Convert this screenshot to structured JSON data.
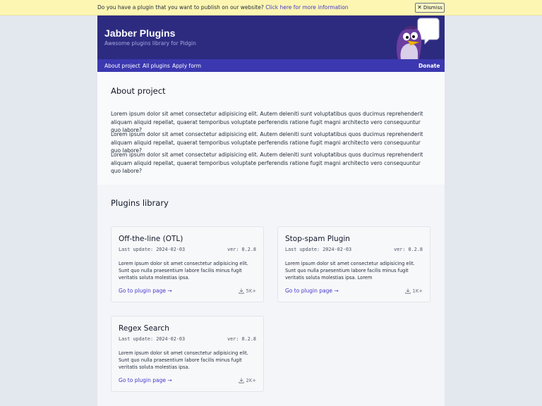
{
  "banner": {
    "text": "Do you have a plugin that you want to publish on our website?",
    "link": "Click here for more information",
    "dismiss": "Dismiss"
  },
  "header": {
    "title": "Jabber Plugins",
    "subtitle": "Awesome plugins library for Pidgin"
  },
  "nav": {
    "items": [
      "About project",
      "All plugins",
      "Apply form"
    ],
    "donate": "Donate"
  },
  "about": {
    "title": "About project",
    "paragraphs": [
      "Lorem ipsum dolor sit amet consectetur adipisicing elit. Autem deleniti sunt voluptatibus quos ducimus reprehenderit aliquam aliquid repellat, quaerat temporibus voluptate perferendis ratione fugit magni architecto vero consequuntur quo labore?",
      "Lorem ipsum dolor sit amet consectetur adipisicing elit. Autem deleniti sunt voluptatibus quos ducimus reprehenderit aliquam aliquid repellat, quaerat temporibus voluptate perferendis ratione fugit magni architecto vero consequuntur quo labore?",
      "Lorem ipsum dolor sit amet consectetur adipisicing elit. Autem deleniti sunt voluptatibus quos ducimus reprehenderit aliquam aliquid repellat, quaerat temporibus voluptate perferendis ratione fugit magni architecto vero consequuntur quo labore?"
    ]
  },
  "library": {
    "title": "Plugins library",
    "plugins": [
      {
        "name": "Off-the-line (OTL)",
        "updated": "Last update: 2024-02-03",
        "version": "ver: 0.2.8",
        "description": "Lorem ipsum dolor sit amet consectetur adipisicing elit. Sunt quo nulla praesentium labore facilis minus fugit veritatis soluta molestias ipsa.",
        "link": "Go to plugin page →",
        "downloads": "5K+"
      },
      {
        "name": "Stop-spam Plugin",
        "updated": "Last update: 2024-02-03",
        "version": "ver: 0.2.8",
        "description": "Lorem ipsum dolor sit amet consectetur adipisicing elit. Sunt quo nulla praesentium labore facilis minus fugit veritatis soluta molestias ipsa. Lorem",
        "link": "Go to plugin page →",
        "downloads": "1K+"
      },
      {
        "name": "Regex Search",
        "updated": "Last update: 2024-02-03",
        "version": "ver: 0.2.8",
        "description": "Lorem ipsum dolor sit amet consectetur adipisicing elit. Sunt quo nulla praesentium labore facilis minus fugit veritatis soluta molestias ipsa.",
        "link": "Go to plugin page →",
        "downloads": "2K+"
      }
    ]
  },
  "icons": {
    "dismiss": "close-icon",
    "download": "download-icon",
    "mascot": "pidgin-mascot-logo"
  },
  "colors": {
    "banner": "#fdf6b2",
    "header": "#2d2b80",
    "nav": "#3b38b0",
    "link": "#4338ca"
  }
}
